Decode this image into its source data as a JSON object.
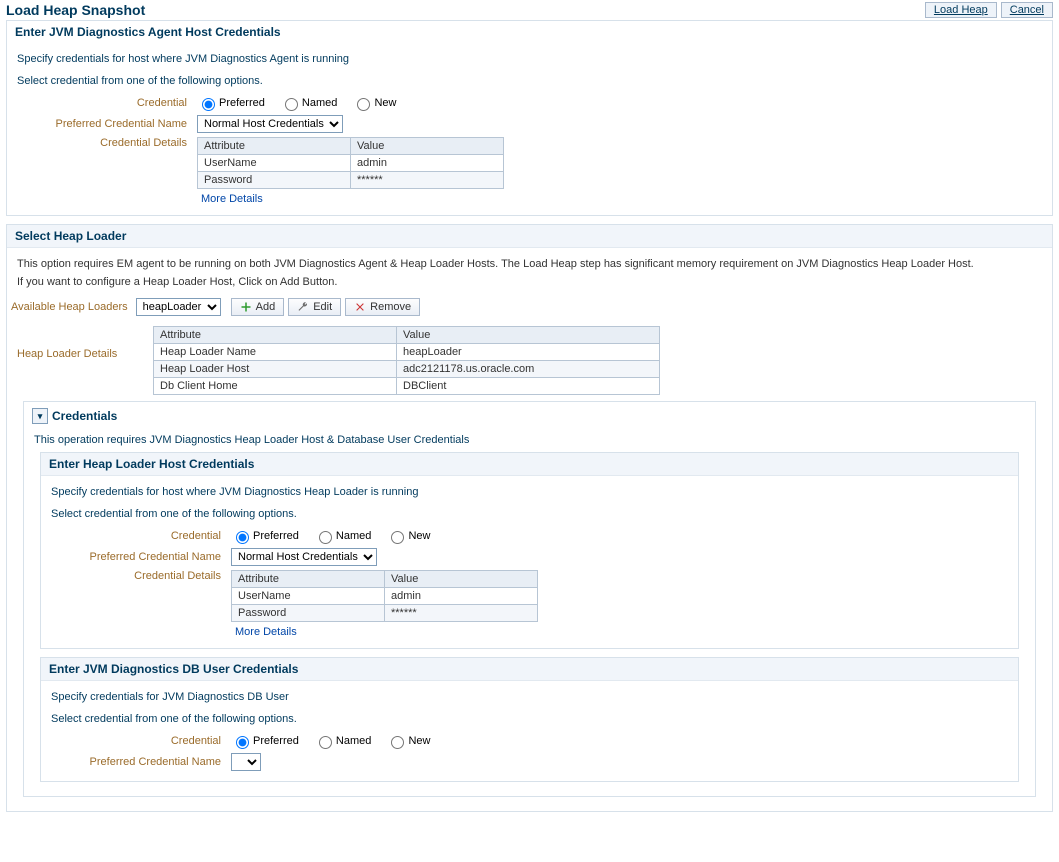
{
  "titlebar": {
    "title": "Load Heap Snapshot",
    "load_heap_btn": "Load Heap",
    "cancel_btn": "Cancel"
  },
  "agent_creds": {
    "header": "Enter JVM Diagnostics Agent Host Credentials",
    "desc": "Specify credentials for host where JVM Diagnostics Agent is running",
    "select_text": "Select credential from one of the following options.",
    "credential_label": "Credential",
    "radio_preferred": "Preferred",
    "radio_named": "Named",
    "radio_new": "New",
    "pref_name_label": "Preferred Credential Name",
    "pref_name_value": "Normal Host Credentials",
    "details_label": "Credential Details",
    "table_hdr_attr": "Attribute",
    "table_hdr_val": "Value",
    "row_user_attr": "UserName",
    "row_user_val": "admin",
    "row_pw_attr": "Password",
    "row_pw_val": "******",
    "more_details": "More Details"
  },
  "heap_loader": {
    "header": "Select Heap Loader",
    "desc": "This option requires EM agent to be running on both JVM Diagnostics Agent & Heap Loader Hosts. The Load Heap step has significant memory requirement on JVM Diagnostics Heap Loader Host.",
    "desc2": "If you want to configure a Heap Loader Host, Click on Add Button.",
    "avail_label": "Available Heap Loaders",
    "select_value": "heapLoader",
    "add_btn": "Add",
    "edit_btn": "Edit",
    "remove_btn": "Remove",
    "details_label": "Heap Loader Details",
    "table_hdr_attr": "Attribute",
    "table_hdr_val": "Value",
    "row1_a": "Heap Loader Name",
    "row1_v": "heapLoader",
    "row2_a": "Heap Loader Host",
    "row2_v": "adc2121178.us.oracle.com",
    "row3_a": "Db Client Home",
    "row3_v": "DBClient"
  },
  "creds_section": {
    "header": "Credentials",
    "desc": "This operation requires JVM Diagnostics Heap Loader Host & Database User Credentials"
  },
  "hl_creds": {
    "header": "Enter Heap Loader Host Credentials",
    "desc": "Specify credentials for host where JVM Diagnostics Heap Loader is running",
    "select_text": "Select credential from one of the following options.",
    "credential_label": "Credential",
    "radio_preferred": "Preferred",
    "radio_named": "Named",
    "radio_new": "New",
    "pref_name_label": "Preferred Credential Name",
    "pref_name_value": "Normal Host Credentials",
    "details_label": "Credential Details",
    "table_hdr_attr": "Attribute",
    "table_hdr_val": "Value",
    "row_user_attr": "UserName",
    "row_user_val": "admin",
    "row_pw_attr": "Password",
    "row_pw_val": "******",
    "more_details": "More Details"
  },
  "db_creds": {
    "header": "Enter JVM Diagnostics DB User Credentials",
    "desc": "Specify credentials for JVM Diagnostics DB User",
    "select_text": "Select credential from one of the following options.",
    "credential_label": "Credential",
    "radio_preferred": "Preferred",
    "radio_named": "Named",
    "radio_new": "New",
    "pref_name_label": "Preferred Credential Name"
  }
}
